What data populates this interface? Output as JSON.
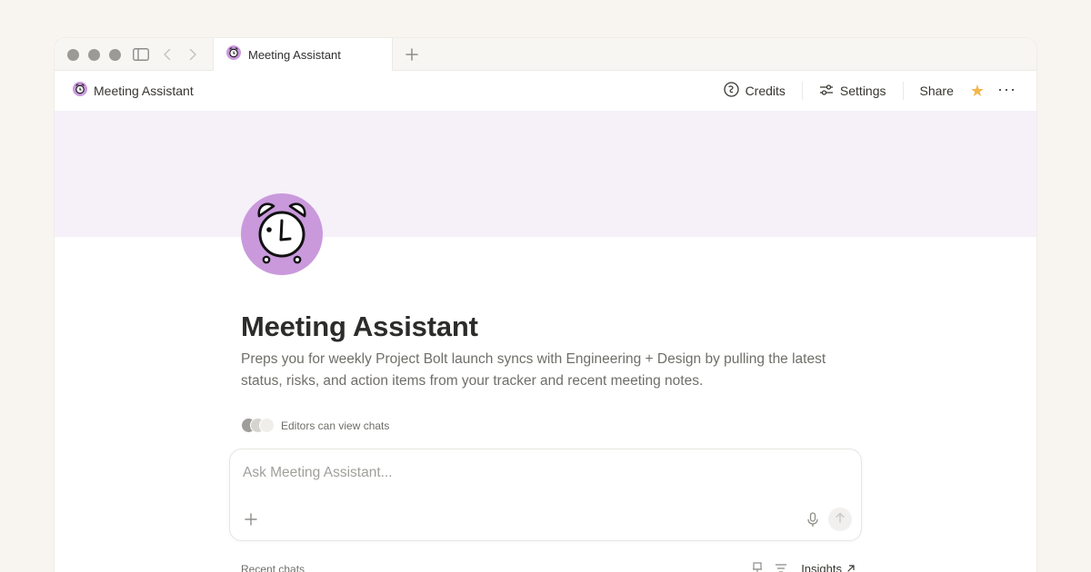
{
  "tab": {
    "title": "Meeting Assistant"
  },
  "breadcrumb": {
    "title": "Meeting Assistant"
  },
  "actions": {
    "credits_label": "Credits",
    "settings_label": "Settings",
    "share_label": "Share",
    "favorite_color": "#f3b64a"
  },
  "cover": {
    "color": "#f6f0f9"
  },
  "avatar": {
    "color": "#c999dc",
    "icon": "alarm-clock-icon"
  },
  "agent": {
    "title": "Meeting Assistant",
    "description": "Preps you for weekly Project Bolt launch syncs with Engineering + Design by pulling the latest status, risks, and action items from your tracker and recent meeting notes."
  },
  "permissions": {
    "text": "Editors can view chats"
  },
  "chat": {
    "placeholder": "Ask Meeting Assistant..."
  },
  "recent": {
    "label": "Recent chats",
    "insights_label": "Insights"
  }
}
